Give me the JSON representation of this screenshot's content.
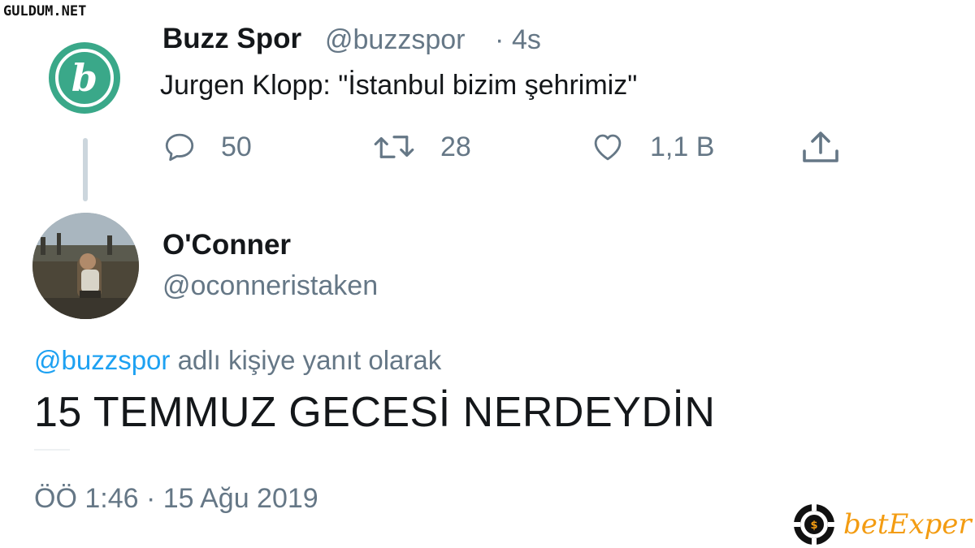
{
  "watermark_top": "GULDUM.NET",
  "original_tweet": {
    "name": "Buzz Spor",
    "handle": "@buzzspor",
    "separator": "·",
    "time": "4s",
    "text": "Jurgen Klopp: \"İstanbul bizim şehrimiz\"",
    "actions": {
      "reply_count": "50",
      "retweet_count": "28",
      "like_count": "1,1 B"
    },
    "avatar_color": "#3aa889"
  },
  "reply_tweet": {
    "name": "O'Conner",
    "handle": "@oconneristaken",
    "replying_mention": "@buzzspor",
    "replying_suffix": " adlı kişiye yanıt olarak",
    "text": "15 TEMMUZ GECESİ NERDEYDİN",
    "timestamp": "ÖÖ 1:46 · 15 Ağu 2019"
  },
  "watermark_brand": "betExper",
  "colors": {
    "accent": "#1da1f2",
    "muted": "#657786",
    "brand": "#f39c12"
  }
}
